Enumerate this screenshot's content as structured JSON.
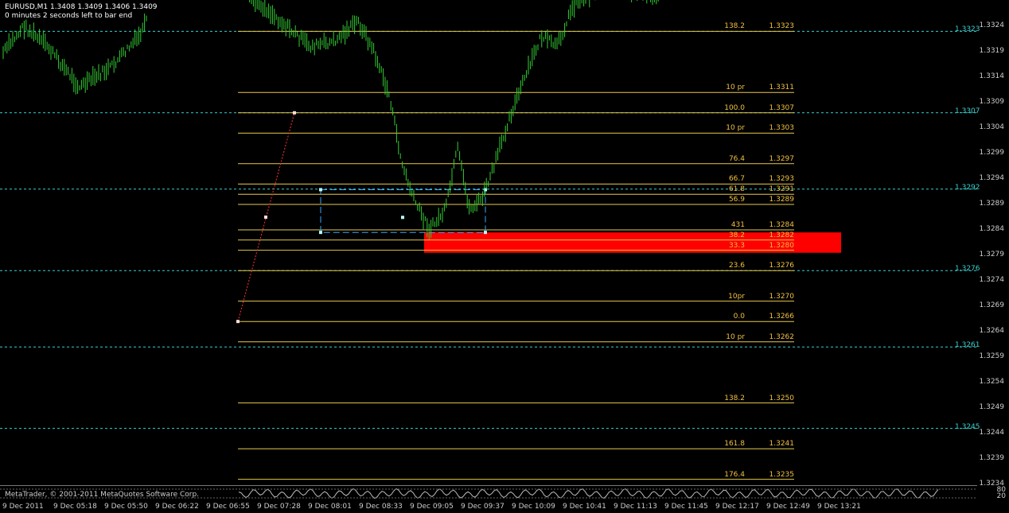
{
  "header": {
    "symbol_line": "EURUSD,M1  1.3408 1.3409 1.3406 1.3409",
    "timer_line": "0 minutes 2 seconds left to bar end"
  },
  "colors": {
    "background": "#000000",
    "candles": "#33cc33",
    "fib_lines": "#e6c84a",
    "fib_labels": "#f0c040",
    "cyan_levels": "#3ad0d0",
    "zone_fill": "#ff0000",
    "trendline": "#ff3333",
    "selection_box": "#39a9ff"
  },
  "price_axis": {
    "labels": [
      "1.3324",
      "1.3319",
      "1.3314",
      "1.3309",
      "1.3304",
      "1.3299",
      "1.3294",
      "1.3289",
      "1.3284",
      "1.3279",
      "1.3274",
      "1.3269",
      "1.3264",
      "1.3259",
      "1.3254",
      "1.3249",
      "1.3244",
      "1.3239",
      "1.3234"
    ]
  },
  "cyan_levels": [
    {
      "price": "1.3323",
      "value": 1.3323
    },
    {
      "price": "1.3307",
      "value": 1.3307
    },
    {
      "price": "1.3292",
      "value": 1.3292
    },
    {
      "price": "1.3276",
      "value": 1.3276
    },
    {
      "price": "1.3261",
      "value": 1.3261
    },
    {
      "price": "1.3245",
      "value": 1.3245
    }
  ],
  "fib_levels": [
    {
      "pct": "138.2",
      "price": "1.3323",
      "value": 1.3323
    },
    {
      "pct": "10 pr",
      "price": "1.3311",
      "value": 1.3311
    },
    {
      "pct": "100.0",
      "price": "1.3307",
      "value": 1.3307
    },
    {
      "pct": "10 pr",
      "price": "1.3303",
      "value": 1.3303
    },
    {
      "pct": "76.4",
      "price": "1.3297",
      "value": 1.3297
    },
    {
      "pct": "66.7",
      "price": "1.3293",
      "value": 1.3293
    },
    {
      "pct": "61.8",
      "price": "1.3291",
      "value": 1.3291
    },
    {
      "pct": "56.9",
      "price": "1.3289",
      "value": 1.3289
    },
    {
      "pct": "431",
      "price": "1.3284",
      "value": 1.3284
    },
    {
      "pct": "38.2",
      "price": "1.3282",
      "value": 1.3282
    },
    {
      "pct": "33.3",
      "price": "1.3280",
      "value": 1.328
    },
    {
      "pct": "23.6",
      "price": "1.3276",
      "value": 1.3276
    },
    {
      "pct": "10pr",
      "price": "1.3270",
      "value": 1.327
    },
    {
      "pct": "0.0",
      "price": "1.3266",
      "value": 1.3266
    },
    {
      "pct": "10 pr",
      "price": "1.3262",
      "value": 1.3262
    },
    {
      "pct": "138.2",
      "price": "1.3250",
      "value": 1.325
    },
    {
      "pct": "161.8",
      "price": "1.3241",
      "value": 1.3241
    },
    {
      "pct": "176.4",
      "price": "1.3235",
      "value": 1.3235
    }
  ],
  "zone": {
    "top": 1.32835,
    "bottom": 1.32795
  },
  "time_axis": {
    "labels": [
      "9 Dec 2011",
      "9 Dec 05:18",
      "9 Dec 05:50",
      "9 Dec 06:22",
      "9 Dec 06:55",
      "9 Dec 07:28",
      "9 Dec 08:01",
      "9 Dec 08:33",
      "9 Dec 09:05",
      "9 Dec 09:37",
      "9 Dec 10:09",
      "9 Dec 10:41",
      "9 Dec 11:13",
      "9 Dec 11:45",
      "9 Dec 12:17",
      "9 Dec 12:49",
      "9 Dec 13:21"
    ]
  },
  "subwindow": {
    "footer": "MetaTrader, © 2001-2011 MetaQuotes Software Corp.",
    "scale_labels": [
      "80",
      "20"
    ]
  }
}
